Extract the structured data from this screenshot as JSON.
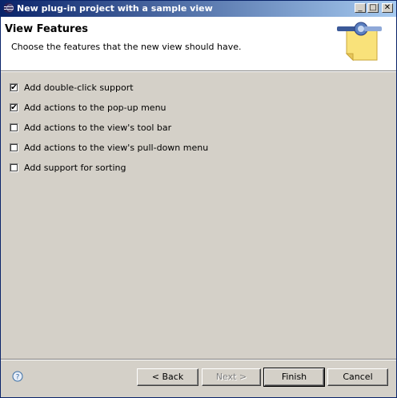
{
  "window": {
    "title": "New plug-in project with a sample view",
    "buttons": {
      "minimize": "_",
      "maximize": "□",
      "close": "✕"
    }
  },
  "header": {
    "title": "View Features",
    "description": "Choose the features that the new view should have."
  },
  "options": [
    {
      "label": "Add double-click support",
      "checked": true
    },
    {
      "label": "Add actions to the pop-up menu",
      "checked": true
    },
    {
      "label": "Add actions to the view's tool bar",
      "checked": false
    },
    {
      "label": "Add actions to the view's pull-down menu",
      "checked": false
    },
    {
      "label": "Add support for sorting",
      "checked": false
    }
  ],
  "footer": {
    "help_icon": "?",
    "back": "< Back",
    "next": "Next >",
    "finish": "Finish",
    "cancel": "Cancel"
  },
  "check_glyph": "✔",
  "colors": {
    "titlebar_start": "#0a246a",
    "titlebar_end": "#a6caf0",
    "dialog_bg": "#d4d0c8"
  }
}
